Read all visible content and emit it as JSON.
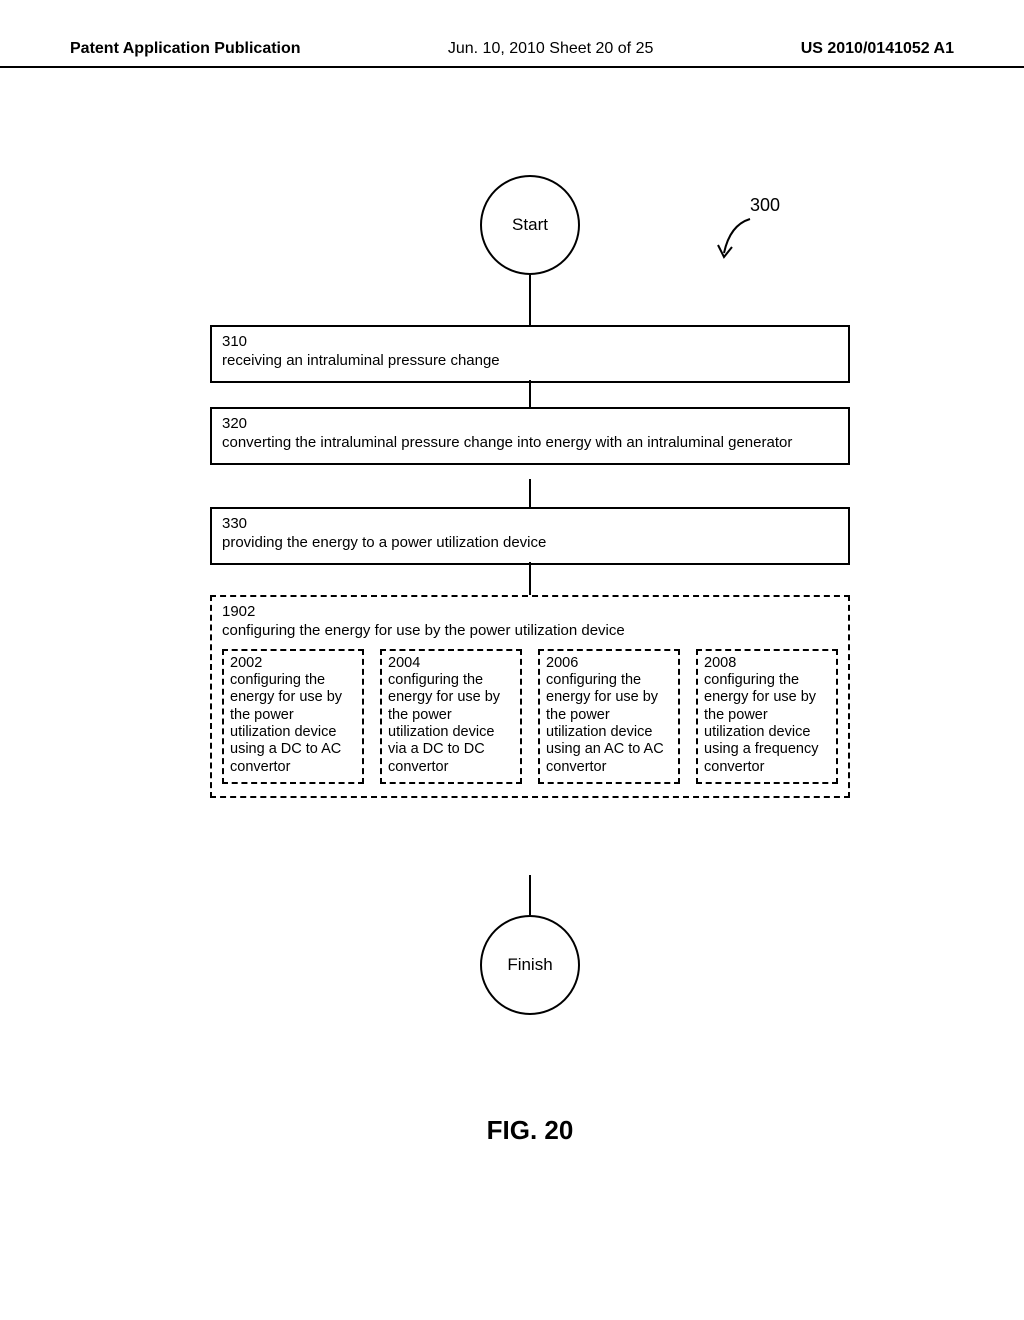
{
  "header": {
    "left": "Patent Application Publication",
    "center": "Jun. 10, 2010  Sheet 20 of 25",
    "right": "US 2010/0141052 A1"
  },
  "ref": {
    "label": "300"
  },
  "start": {
    "label": "Start"
  },
  "finish": {
    "label": "Finish"
  },
  "box310": {
    "num": "310",
    "text": "receiving an intraluminal pressure change"
  },
  "box320": {
    "num": "320",
    "text": "converting the intraluminal pressure change into energy with an intraluminal generator"
  },
  "box330": {
    "num": "330",
    "text": "providing the energy to a power utilization device"
  },
  "box1902": {
    "num": "1902",
    "text": "configuring the energy for use by the power utilization device"
  },
  "box2002": {
    "num": "2002",
    "text": "configuring the energy for use by the power utilization device using a DC to AC convertor"
  },
  "box2004": {
    "num": "2004",
    "text": "configuring the energy for use by the power utilization device via a DC to DC convertor"
  },
  "box2006": {
    "num": "2006",
    "text": "configuring the energy for use by the power utilization device using an AC to AC convertor"
  },
  "box2008": {
    "num": "2008",
    "text": "configuring the energy for use by the power utilization device using a frequency convertor"
  },
  "figure": {
    "caption": "FIG. 20"
  }
}
